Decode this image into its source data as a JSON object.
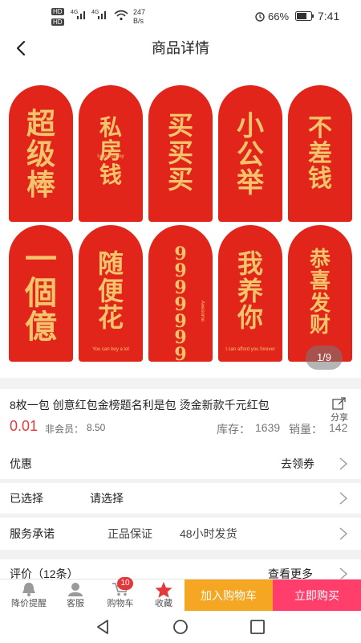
{
  "status_bar": {
    "net1": "HD",
    "net2": "HD",
    "signal1": "4G",
    "signal2": "4G",
    "speed_value": "247",
    "speed_unit": "B/s",
    "battery": "66%",
    "time": "7:41"
  },
  "header": {
    "title": "商品详情"
  },
  "gallery": {
    "pager": "1/9",
    "envelopes": [
      {
        "text": "超级棒",
        "small": ""
      },
      {
        "text": "私房钱",
        "small": "lucky money"
      },
      {
        "text": "买买买",
        "small": ""
      },
      {
        "text": "小公举",
        "small": ""
      },
      {
        "text": "不差钱",
        "small": ""
      },
      {
        "text": "一個億",
        "small": ""
      },
      {
        "text": "随便花",
        "small": "You can buy a lot"
      },
      {
        "text": "9999999",
        "small": "Awesome"
      },
      {
        "text": "我养你",
        "small": "I can afford you forever"
      },
      {
        "text": "恭喜发财",
        "small": ""
      }
    ]
  },
  "product": {
    "title": "8枚一包 创意红包金榜题名利是包 烫金新款千元红包",
    "share_label": "分享",
    "price": "0.01",
    "member_price_label": "非会员：",
    "member_price": "8.50",
    "stock_label": "库存：",
    "stock": "1639",
    "sales_label": "销量：",
    "sales": "142"
  },
  "rows": {
    "discount_label": "优惠",
    "discount_action": "去领券",
    "selected_label": "已选择",
    "selected_value": "请选择",
    "service_label": "服务承诺",
    "service_1": "正品保证",
    "service_2": "48小时发货",
    "review_label": "评价（12条）",
    "review_action": "查看更多"
  },
  "bottom_bar": {
    "tab_price_alert": "降价提醒",
    "tab_service": "客服",
    "tab_cart": "购物车",
    "cart_badge": "10",
    "tab_favorite": "收藏",
    "add_to_cart": "加入购物车",
    "buy_now": "立即购买",
    "add_to_cart_color": "#f5a623",
    "buy_now_color": "#ff3e6c"
  }
}
